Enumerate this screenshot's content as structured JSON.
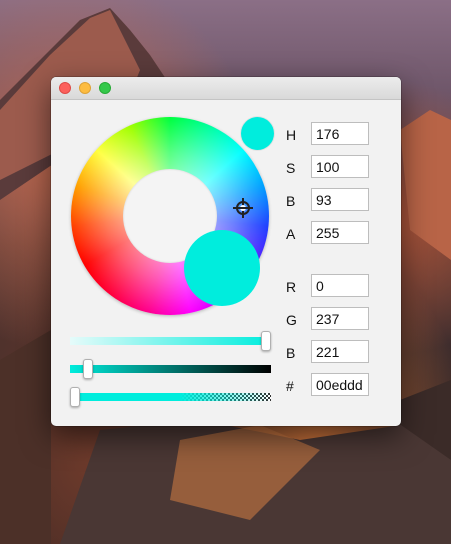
{
  "window": {
    "title_buttons": [
      "close-button",
      "minimize-button",
      "zoom-button"
    ]
  },
  "color": {
    "hex_display": "#00eddd",
    "h_label": "H",
    "h_value": "176",
    "s_label": "S",
    "s_value": "100",
    "b_label": "B",
    "b_value": "93",
    "a_label": "A",
    "a_value": "255",
    "r_label": "R",
    "r_value": "0",
    "g_label": "G",
    "g_value": "237",
    "blue_label": "B",
    "blue_value": "221",
    "hex_label": "#",
    "hex_value": "00eddd"
  },
  "sliders": {
    "lightness_level": 1.0,
    "brightness_level": 0.07,
    "alpha_level": 0.0
  },
  "icons": [
    "picker-handle-icon",
    "color-wheel"
  ]
}
